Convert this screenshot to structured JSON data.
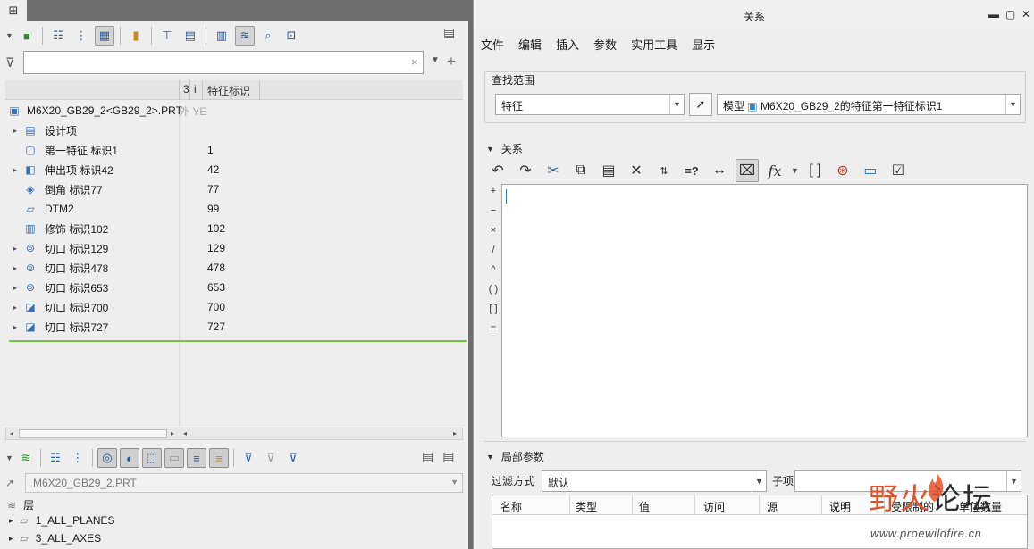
{
  "left_panel": {
    "toolbar_icons": [
      "tree-filters-icon",
      "show-columns-icon",
      "tree-settings-icon",
      "bookmark-icon",
      "tree-columns-icon",
      "table-icon",
      "list-icon",
      "layers-icon",
      "note-icon",
      "structure-icon"
    ],
    "filter": {
      "value": "",
      "placeholder": ""
    },
    "columns": {
      "c1": "3",
      "c2": "i",
      "c3": "特征标识"
    },
    "root": {
      "label": "M6X20_GB29_2<GB29_2>.PRT",
      "extra": "外 YE"
    },
    "tree_items": [
      {
        "label": "设计项",
        "id": "",
        "icon": "design-items-icon",
        "expandable": true
      },
      {
        "label": "第一特征 标识1",
        "id": "1",
        "icon": "first-feature-icon",
        "expandable": false
      },
      {
        "label": "伸出项 标识42",
        "id": "42",
        "icon": "protrusion-icon",
        "expandable": true
      },
      {
        "label": "倒角 标识77",
        "id": "77",
        "icon": "chamfer-icon",
        "expandable": false
      },
      {
        "label": "DTM2",
        "id": "99",
        "icon": "datum-plane-icon",
        "expandable": false
      },
      {
        "label": "修饰 标识102",
        "id": "102",
        "icon": "cosmetic-icon",
        "expandable": false
      },
      {
        "label": "切口 标识129",
        "id": "129",
        "icon": "cut-icon",
        "expandable": true
      },
      {
        "label": "切口 标识478",
        "id": "478",
        "icon": "cut-icon",
        "expandable": true
      },
      {
        "label": "切口 标识653",
        "id": "653",
        "icon": "cut-icon",
        "expandable": true
      },
      {
        "label": "切口 标识700",
        "id": "700",
        "icon": "cut-solid-icon",
        "expandable": true
      },
      {
        "label": "切口 标识727",
        "id": "727",
        "icon": "cut-solid-icon",
        "expandable": true
      }
    ],
    "layer_model": "M6X20_GB29_2.PRT",
    "layer_title": "层",
    "layers": [
      "1_ALL_PLANES",
      "3_ALL_AXES"
    ]
  },
  "dialog": {
    "title": "关系",
    "menu": [
      "文件",
      "编辑",
      "插入",
      "参数",
      "实用工具",
      "显示"
    ],
    "scope_legend": "查找范围",
    "scope_type": "特征",
    "scope_prefix": "模型",
    "scope_target": "M6X20_GB29_2的特征第一特征标识1",
    "relations_section": "关系",
    "toolbar_icons": [
      "undo-icon",
      "redo-icon",
      "cut-icon",
      "copy-icon",
      "paste-icon",
      "delete-icon",
      "sort-icon",
      "evaluate-icon",
      "dimension-icon",
      "show-dimension-icon",
      "function-icon",
      "braces-icon",
      "verify-icon",
      "units-icon",
      "check-icon"
    ],
    "operators": [
      "+",
      "−",
      "×",
      "/",
      "^",
      "( )",
      "[ ]",
      "="
    ],
    "editor_text": "",
    "params_section": "局部参数",
    "filter_label": "过滤方式",
    "filter_value": "默认",
    "subitem_label": "子项",
    "subitem_value": "",
    "param_columns": [
      "名称",
      "类型",
      "值",
      "访问",
      "源",
      "说明",
      "受限制的",
      "单位数量"
    ]
  },
  "watermark": {
    "text_red": "野火",
    "text_dark": "论坛",
    "url": "www.proewildfire.cn"
  },
  "colors": {
    "accent_green": "#7bc24a",
    "watermark_red": "#e0522b",
    "icon_blue": "#3a6fb0"
  }
}
